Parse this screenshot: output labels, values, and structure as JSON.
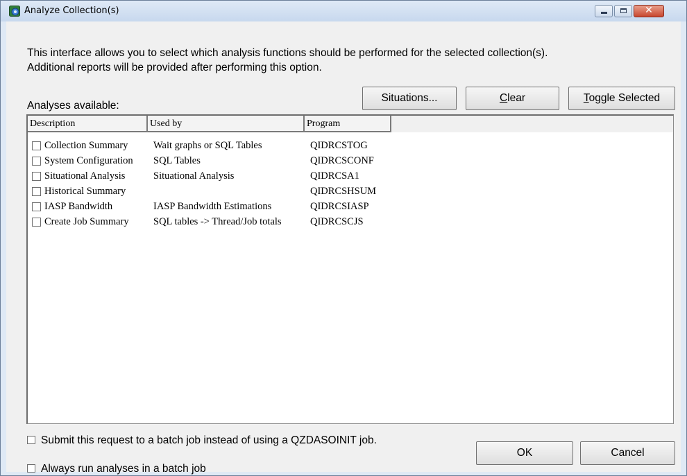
{
  "window": {
    "title": "Analyze Collection(s)"
  },
  "intro": {
    "line1": "This interface allows you to select which analysis functions should be performed for the selected collection(s).",
    "line2": "Additional reports will be provided after performing this option."
  },
  "analyses_label": "Analyses available:",
  "buttons": {
    "situations": "Situations...",
    "clear_first": "C",
    "clear_rest": "lear",
    "toggle_first": "T",
    "toggle_rest": "oggle Selected",
    "ok": "OK",
    "cancel": "Cancel"
  },
  "columns": [
    "Description",
    "Used by",
    "Program"
  ],
  "rows": [
    {
      "description": "Collection Summary",
      "used_by": "Wait graphs or SQL Tables",
      "program": "QIDRCSTOG",
      "checked": false
    },
    {
      "description": "System Configuration",
      "used_by": "SQL Tables",
      "program": "QIDRCSCONF",
      "checked": false
    },
    {
      "description": "Situational Analysis",
      "used_by": "Situational Analysis",
      "program": "QIDRCSA1",
      "checked": false
    },
    {
      "description": "Historical Summary",
      "used_by": "",
      "program": "QIDRCSHSUM",
      "checked": false
    },
    {
      "description": "IASP Bandwidth",
      "used_by": "IASP Bandwidth Estimations",
      "program": "QIDRCSIASP",
      "checked": false
    },
    {
      "description": "Create Job Summary",
      "used_by": "SQL tables -> Thread/Job totals",
      "program": "QIDRCSCJS",
      "checked": false
    }
  ],
  "options": {
    "batch_submit": "Submit this request to a batch job instead of using a QZDASOINIT job.",
    "always_batch": "Always run analyses in a batch job"
  }
}
